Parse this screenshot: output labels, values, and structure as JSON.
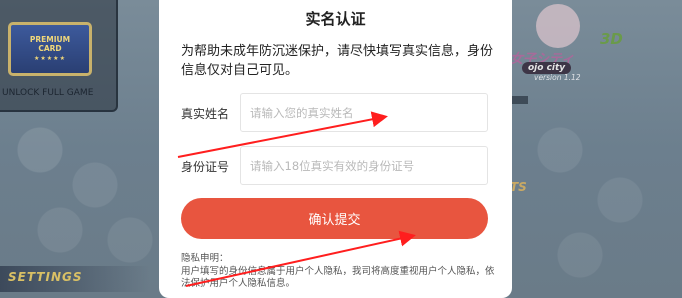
{
  "background": {
    "premium_card": {
      "line1": "PREMIUM",
      "line2": "CARD",
      "stars": "★★★★★"
    },
    "unlock_label": "UNLOCK FULL GAME",
    "settings_label": "SETTINGS",
    "logo": {
      "title": "女子シティ",
      "mark_3d": "3D",
      "subtitle": "ojo city",
      "version": "version 1.12"
    },
    "side_text": "TS"
  },
  "modal": {
    "title": "实名认证",
    "description": "为帮助未成年防沉迷保护，请尽快填写真实信息，身份信息仅对自己可见。",
    "fields": {
      "name": {
        "label": "真实姓名",
        "placeholder": "请输入您的真实姓名",
        "value": ""
      },
      "id": {
        "label": "身份证号",
        "placeholder": "请输入18位真实有效的身份证号",
        "value": ""
      }
    },
    "submit_label": "确认提交",
    "privacy_title": "隐私申明：",
    "privacy_text": "用户填写的身份信息属于用户个人隐私，我司将高度重视用户个人隐私，依法保护用户个人隐私信息。"
  },
  "colors": {
    "accent": "#e8553f",
    "arrow": "#ff1e1e"
  }
}
